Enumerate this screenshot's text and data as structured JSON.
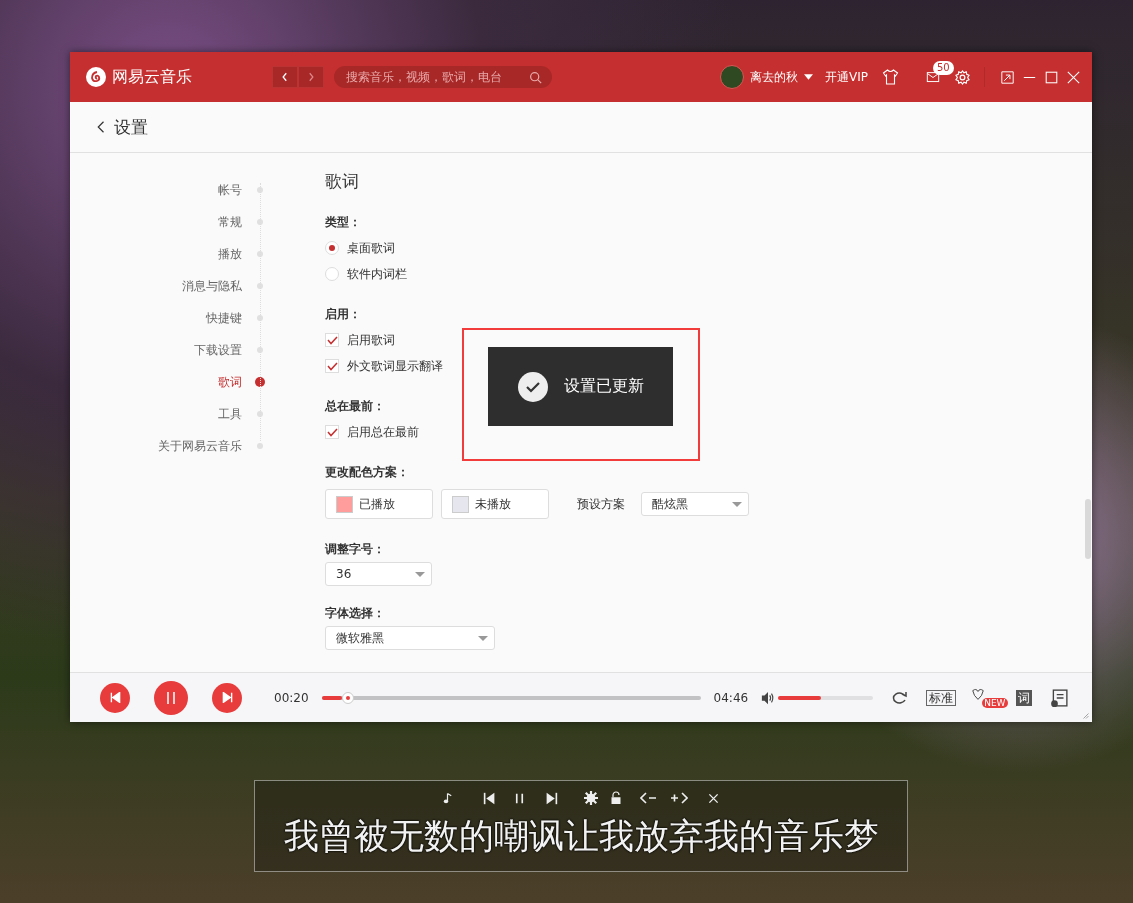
{
  "window": {
    "app_name": "网易云音乐",
    "search_placeholder": "搜索音乐，视频，歌词，电台",
    "user_name": "离去的秋",
    "vip_link": "开通VIP",
    "mail_badge": "50"
  },
  "page": {
    "back_title": "设置"
  },
  "sidebar": {
    "items": [
      {
        "label": "帐号",
        "selected": false
      },
      {
        "label": "常规",
        "selected": false
      },
      {
        "label": "播放",
        "selected": false
      },
      {
        "label": "消息与隐私",
        "selected": false
      },
      {
        "label": "快捷键",
        "selected": false
      },
      {
        "label": "下载设置",
        "selected": false
      },
      {
        "label": "歌词",
        "selected": true
      },
      {
        "label": "工具",
        "selected": false
      },
      {
        "label": "关于网易云音乐",
        "selected": false
      }
    ]
  },
  "section": {
    "title": "歌词",
    "groups": [
      {
        "kind": "radio",
        "label": "类型：",
        "options": [
          {
            "label": "桌面歌词",
            "selected": true
          },
          {
            "label": "软件内词栏",
            "selected": false
          }
        ]
      },
      {
        "kind": "checkbox",
        "label": "启用：",
        "options": [
          {
            "label": "启用歌词",
            "checked": true
          },
          {
            "label": "外文歌词显示翻译",
            "checked": true
          }
        ]
      },
      {
        "kind": "checkbox",
        "label": "总在最前：",
        "options": [
          {
            "label": "启用总在最前",
            "checked": true
          }
        ]
      },
      {
        "kind": "colors",
        "label": "更改配色方案：",
        "swatches": [
          {
            "label": "已播放",
            "color": "#ff9c9c"
          },
          {
            "label": "未播放",
            "color": "#e6e6ee"
          }
        ],
        "preset_label": "预设方案",
        "preset_value": "酷炫黑"
      },
      {
        "kind": "select",
        "label": "调整字号：",
        "value": "36"
      },
      {
        "kind": "select",
        "label": "字体选择：",
        "value": "微软雅黑"
      }
    ]
  },
  "toast": {
    "message": "设置已更新"
  },
  "player": {
    "elapsed": "00:20",
    "progress": {
      "level": 0.07
    },
    "total": "04:46",
    "volume": {
      "level": 0.45
    },
    "quality": "标准",
    "new_badge": "NEW",
    "lyrics_button": "词"
  },
  "desktop_lyrics": {
    "text": "我曾被无数的嘲讽让我放弃我的音乐梦"
  }
}
